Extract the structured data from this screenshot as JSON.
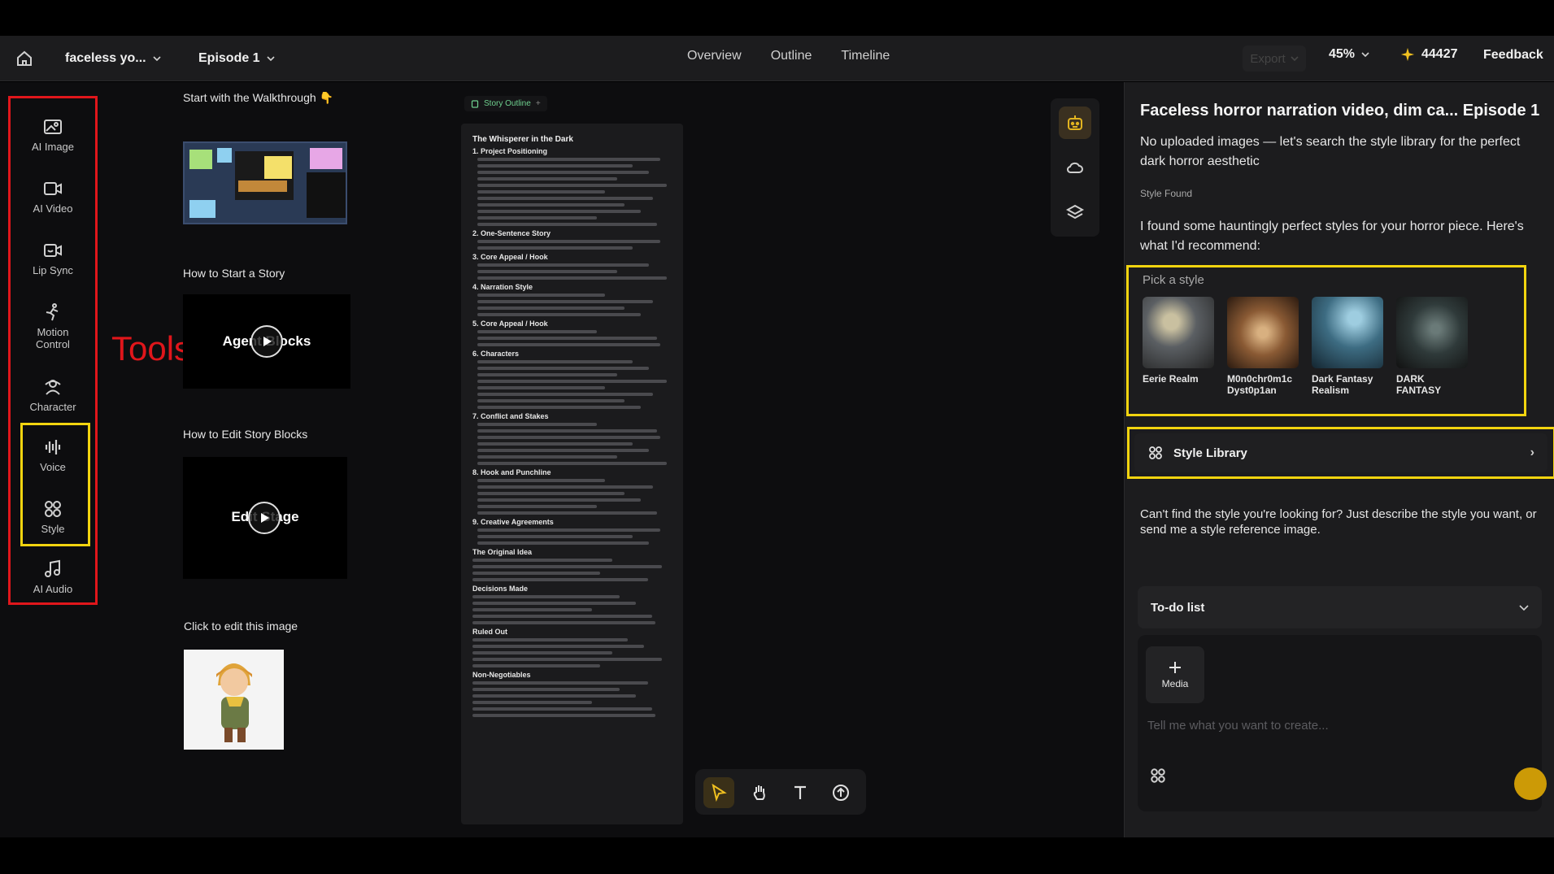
{
  "header": {
    "project_name": "faceless yo...",
    "episode": "Episode 1",
    "nav": [
      "Overview",
      "Outline",
      "Timeline"
    ],
    "export_label": "Export",
    "zoom": "45%",
    "credits": "44427",
    "feedback_label": "Feedback"
  },
  "tools": [
    {
      "label": "AI Image",
      "icon": "ai-image-icon"
    },
    {
      "label": "AI Video",
      "icon": "ai-video-icon"
    },
    {
      "label": "Lip Sync",
      "icon": "lip-sync-icon"
    },
    {
      "label": "Motion\nControl",
      "icon": "motion-control-icon"
    },
    {
      "label": "Character",
      "icon": "character-icon"
    },
    {
      "label": "Voice",
      "icon": "voice-icon"
    },
    {
      "label": "Style",
      "icon": "style-icon"
    },
    {
      "label": "AI Audio",
      "icon": "ai-audio-icon"
    }
  ],
  "tools_annotation": "Tools",
  "walkthrough": {
    "title": "Start with the Walkthrough",
    "emoji": "👇",
    "start_story_title": "How to Start a Story",
    "start_story_video_text": "Agent Blocks",
    "edit_blocks_title": "How to Edit Story Blocks",
    "edit_blocks_video_text": "Edit Stage",
    "edit_image_title": "Click to edit this image"
  },
  "story_outline": {
    "tab_label": "Story Outline",
    "doc_title": "The Whisperer in the Dark",
    "sections": [
      {
        "heading": "1. Project Positioning",
        "lines": 11
      },
      {
        "heading": "2. One-Sentence Story",
        "lines": 2
      },
      {
        "heading": "3. Core Appeal / Hook",
        "lines": 3
      },
      {
        "heading": "4. Narration Style",
        "lines": 4
      },
      {
        "heading": "5. Core Appeal / Hook",
        "lines": 3
      },
      {
        "heading": "6. Characters",
        "lines": 8
      },
      {
        "heading": "7. Conflict and Stakes",
        "lines": 7
      },
      {
        "heading": "8. Hook and Punchline",
        "lines": 6
      },
      {
        "heading": "9. Creative Agreements",
        "lines": 3
      },
      {
        "heading": "The Original Idea",
        "lines": 4
      },
      {
        "heading": "Decisions Made",
        "lines": 5
      },
      {
        "heading": "Ruled Out",
        "lines": 5
      },
      {
        "heading": "Non-Negotiables",
        "lines": 6
      }
    ]
  },
  "chat": {
    "title": "Faceless horror narration video, dim ca... Episode 1",
    "message1": "No uploaded images — let's search the style library for the perfect dark horror aesthetic",
    "style_found": "Style Found",
    "message2": "I found some hauntingly perfect styles for your horror piece. Here's what I'd recommend:",
    "pick_label": "Pick a style",
    "styles": [
      {
        "name": "Eerie Realm",
        "color": "#5b5f63"
      },
      {
        "name": "M0n0chr0m1c Dyst0p1an",
        "color": "#8a5a34"
      },
      {
        "name": "Dark Fantasy Realism",
        "color": "#3d6c82"
      },
      {
        "name": "DARK FANTASY",
        "color": "#2f3a3a"
      }
    ],
    "library_label": "Style Library",
    "message3": "Can't find the style you're looking for? Just describe the style you want, or send me a style reference image.",
    "todo_label": "To-do list",
    "media_label": "Media",
    "prompt_placeholder": "Tell me what you want to create..."
  },
  "colors": {
    "highlight_red": "#e0161b",
    "highlight_yellow": "#f2d40f",
    "accent_gold": "#cc9a06",
    "outline_green": "#6fd18f"
  }
}
